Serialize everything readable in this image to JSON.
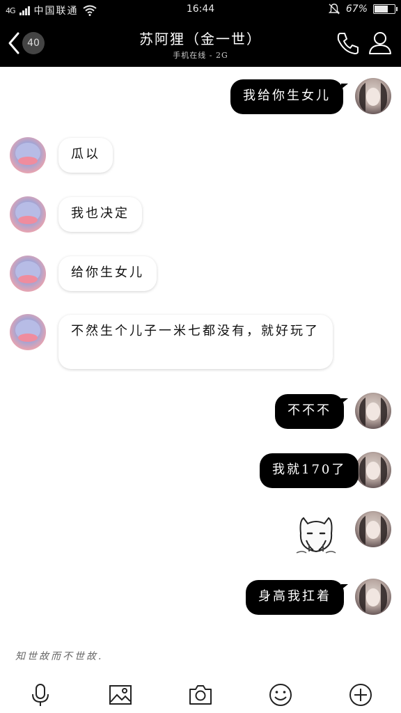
{
  "status_bar": {
    "network": "4G",
    "carrier": "中国联通",
    "time": "16:44",
    "battery_pct": "67%",
    "battery_level": 0.67
  },
  "header": {
    "unread_count": "40",
    "contact_name": "苏阿狸（金一世）",
    "contact_status": "手机在线 - 2G"
  },
  "messages": {
    "m1": "我给你生女儿",
    "m2": "瓜以",
    "m3": "我也决定",
    "m4": "给你生女儿",
    "m5": "不然生个儿子一米七都没有，就好玩了",
    "m6": "不不不",
    "m7": "我就170了",
    "m9": "身高我扛着"
  },
  "signature": "知世故而不世故.",
  "colors": {
    "header_bg": "#000000",
    "my_bubble": "#000000",
    "their_bubble": "#ffffff"
  },
  "icons": [
    "back-arrow-icon",
    "phone-icon",
    "profile-icon",
    "microphone-icon",
    "image-icon",
    "camera-icon",
    "emoji-icon",
    "plus-icon"
  ]
}
